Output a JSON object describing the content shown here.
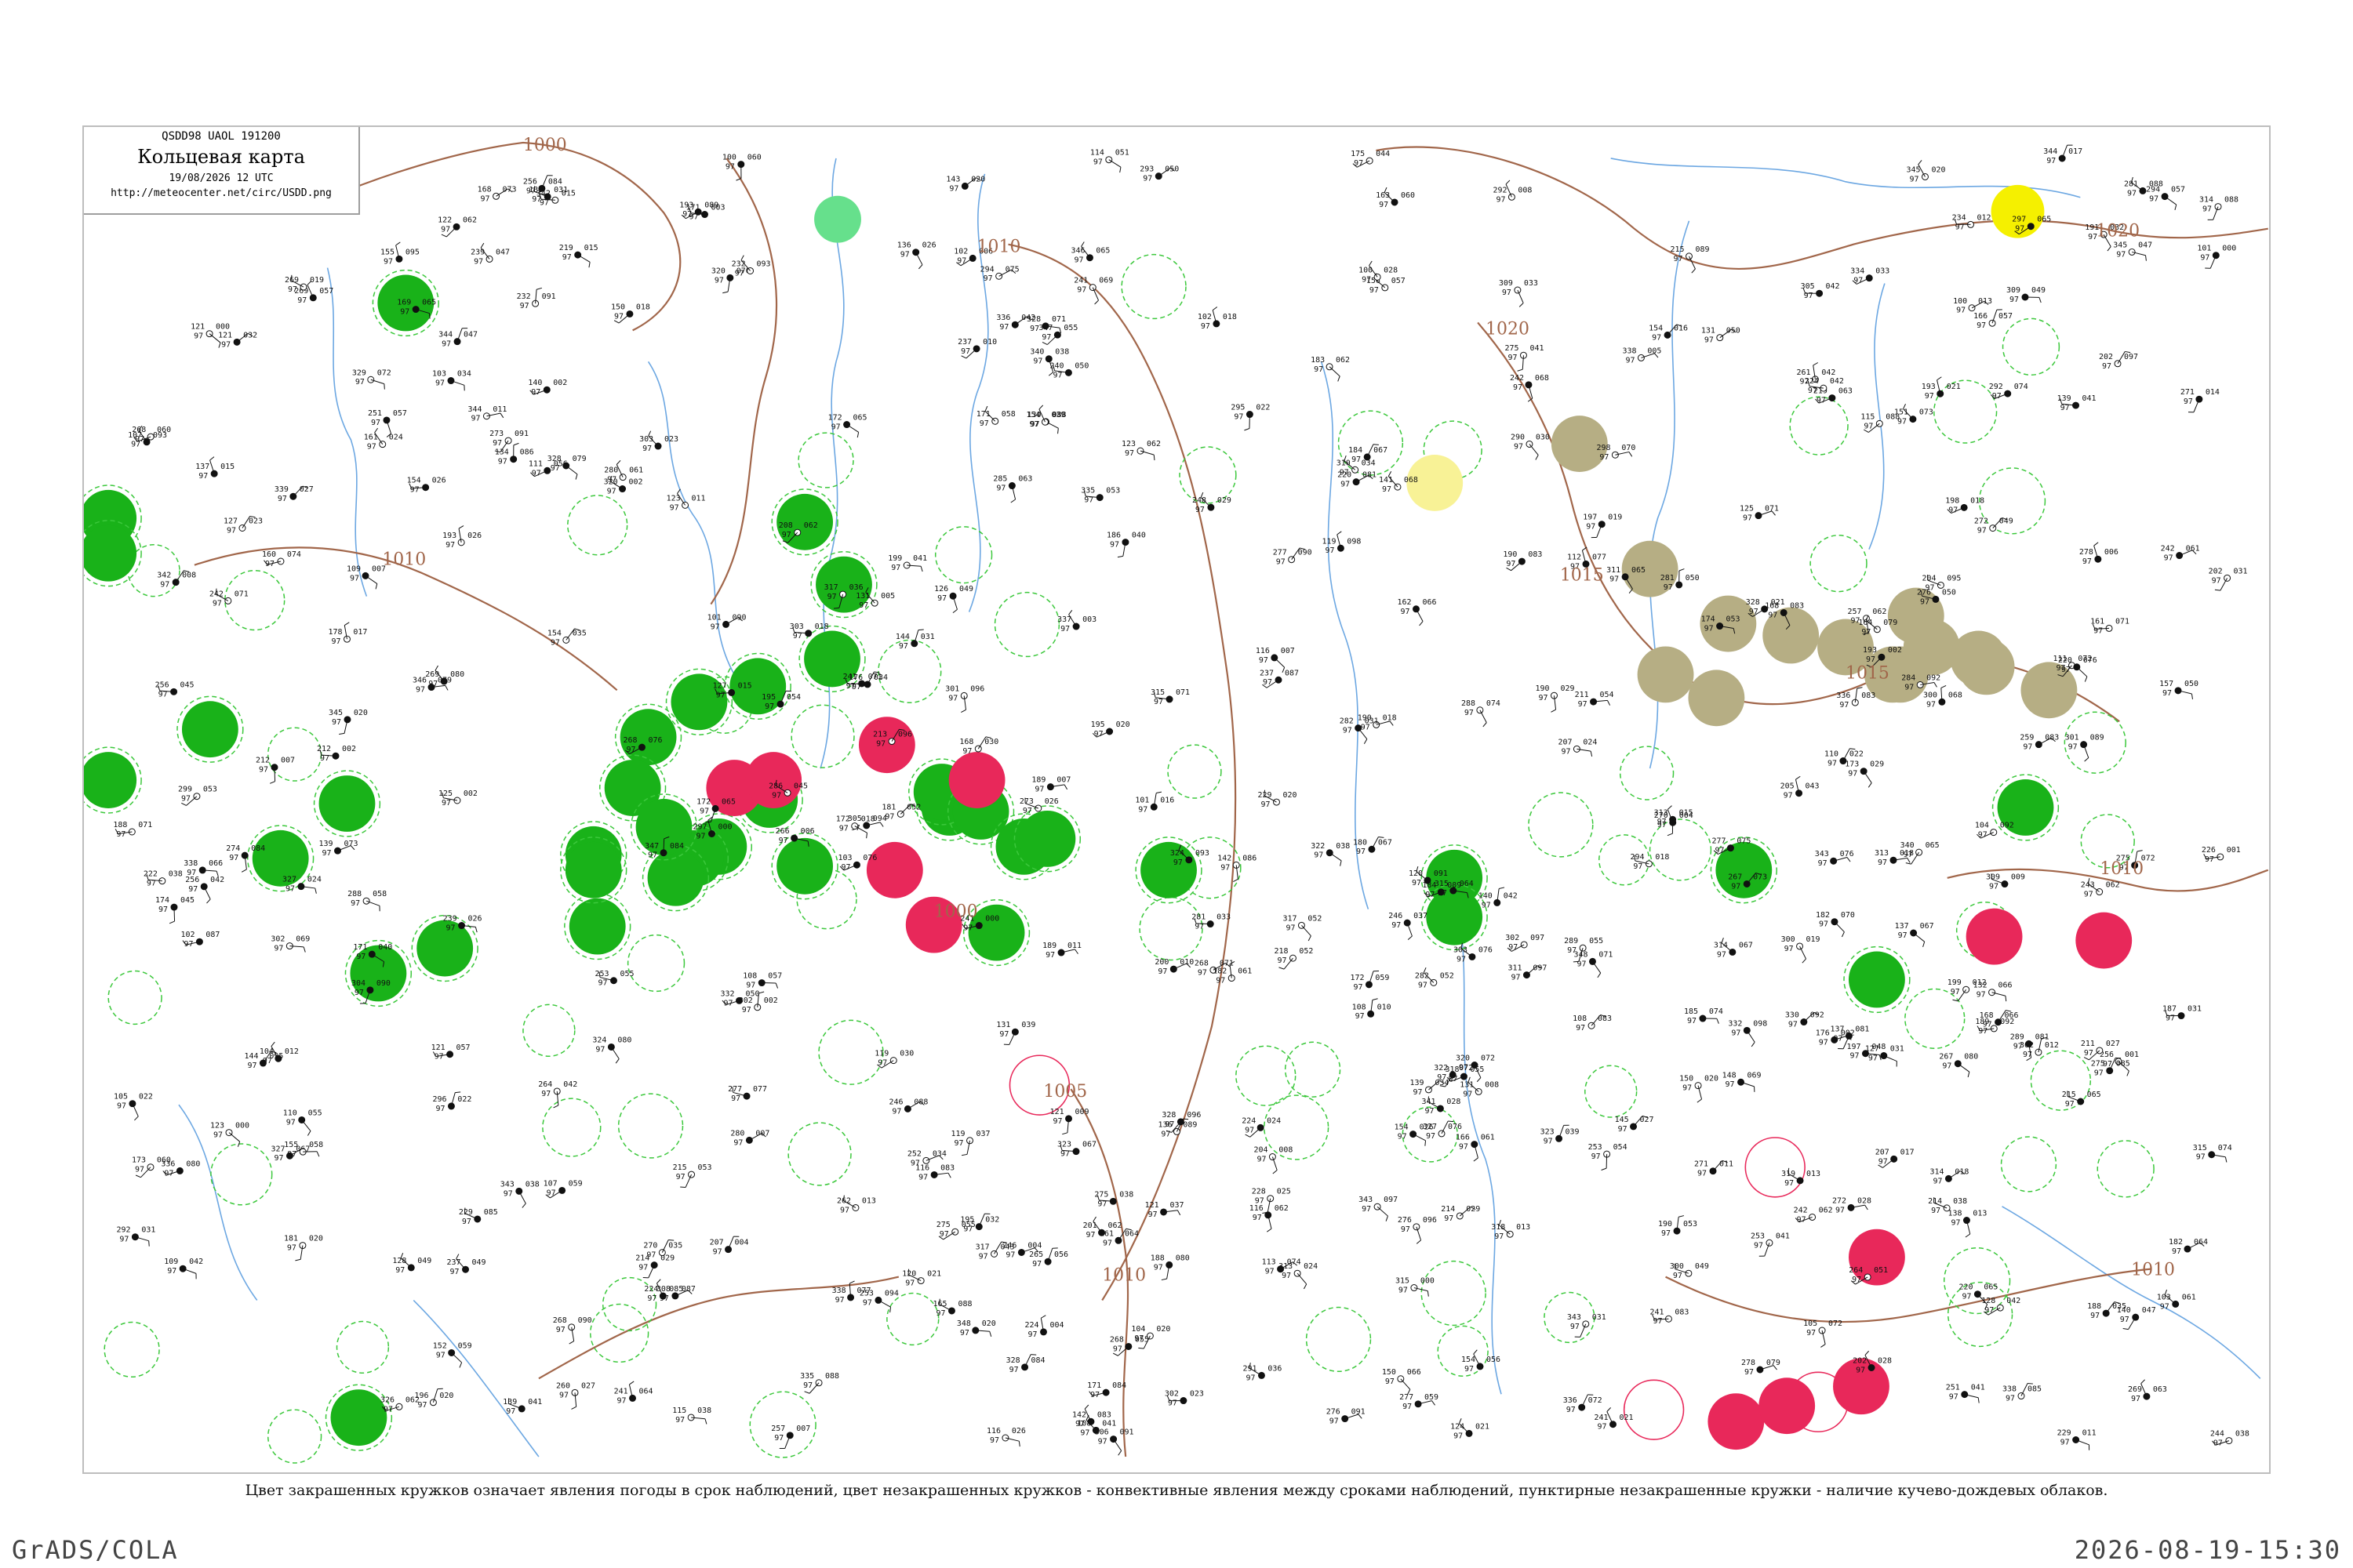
{
  "title_box": {
    "code": "QSDD98  UAOL  191200",
    "title": "Кольцевая карта",
    "date": "19/08/2026 12 UTC",
    "url": "http://meteocenter.net/circ/USDD.png"
  },
  "isobar_labels": [
    "1000",
    "1010",
    "1010",
    "1000",
    "1005",
    "1010",
    "1020",
    "1015",
    "1015",
    "1020",
    "1010",
    "1010"
  ],
  "colors": {
    "rain_green": "#19b219",
    "thunder_red": "#e8285a",
    "olive": "#b6ae84",
    "yellow": "#f5f000",
    "light_yellow": "#f8f296",
    "mint": "#66e08c",
    "conv_green": "#3cc83c",
    "conv_red": "#e8285a",
    "isobar": "#a1664a",
    "river": "#3b8ad8"
  },
  "station_markers": {
    "filled_green": 38,
    "filled_red": 11,
    "filled_olive": 14,
    "filled_yellow": 1,
    "filled_light_yellow": 1,
    "filled_mint": 1,
    "dashed_green_rings": 60,
    "solid_red_rings": 4
  },
  "caption": "Цвет закрашенных кружков означает явления погоды в срок наблюдений, цвет незакрашенных кружков - конвективные явления между сроками наблюдений, пунктирные незакрашенные кружки - наличие кучево-дождевых облаков.",
  "footer": {
    "left": "GrADS/COLA",
    "right": "2026-08-19-15:30"
  }
}
